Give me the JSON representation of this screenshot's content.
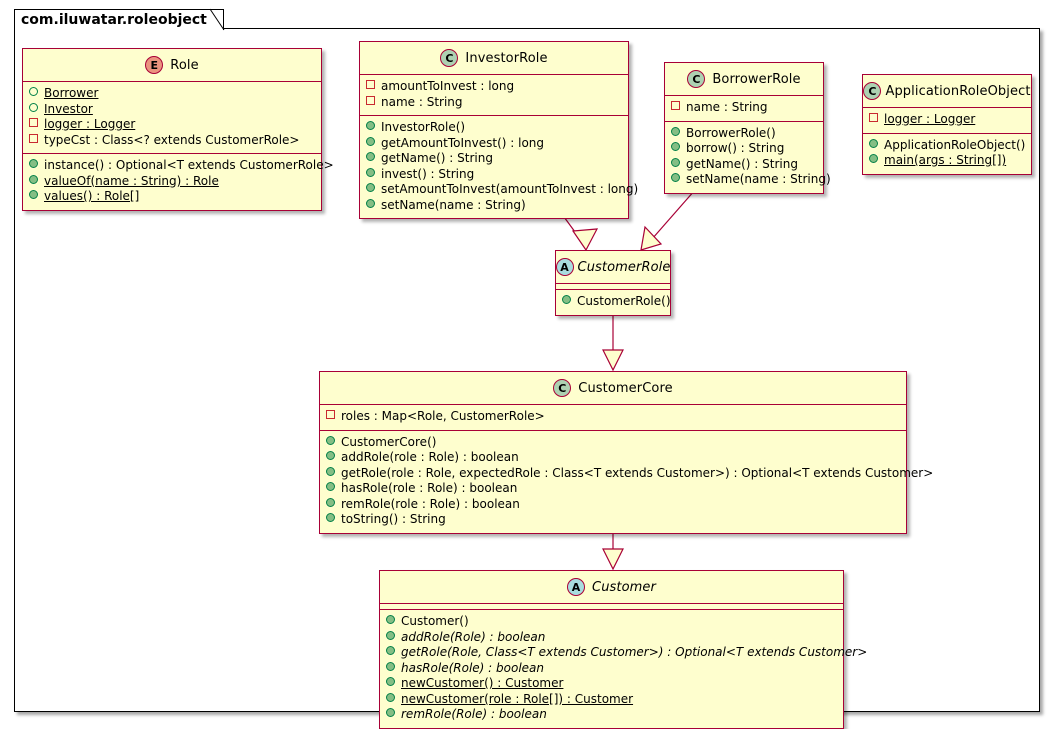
{
  "package": {
    "name": "com.iluwatar.roleobject"
  },
  "colors": {
    "box_fill": "#FEFECE",
    "box_border": "#A80036",
    "class_badge": "#ADD1B2",
    "abstract_badge": "#A9DCDF",
    "enum_badge": "#EB937F",
    "link": "#A80036",
    "public_member": "#84BE84",
    "private_member": "#C82930"
  },
  "classes": {
    "role": {
      "name": "Role",
      "stereotype": "E",
      "stereotype_name": "enum",
      "fields": [
        {
          "icon": "field-public",
          "text": "Borrower",
          "style": "underline"
        },
        {
          "icon": "field-public",
          "text": "Investor",
          "style": "underline"
        },
        {
          "icon": "field-private",
          "text": "logger : Logger",
          "style": "underline"
        },
        {
          "icon": "field-private",
          "text": "typeCst : Class<? extends CustomerRole>",
          "style": ""
        }
      ],
      "methods": [
        {
          "icon": "method-public",
          "text": "instance() : Optional<T extends CustomerRole>",
          "style": ""
        },
        {
          "icon": "method-public",
          "text": "valueOf(name : String) : Role",
          "style": "underline"
        },
        {
          "icon": "method-public",
          "text": "values() : Role[]",
          "style": "underline"
        }
      ]
    },
    "investor_role": {
      "name": "InvestorRole",
      "stereotype": "C",
      "stereotype_name": "class",
      "fields": [
        {
          "icon": "field-private",
          "text": "amountToInvest : long",
          "style": ""
        },
        {
          "icon": "field-private",
          "text": "name : String",
          "style": ""
        }
      ],
      "methods": [
        {
          "icon": "method-public",
          "text": "InvestorRole()",
          "style": ""
        },
        {
          "icon": "method-public",
          "text": "getAmountToInvest() : long",
          "style": ""
        },
        {
          "icon": "method-public",
          "text": "getName() : String",
          "style": ""
        },
        {
          "icon": "method-public",
          "text": "invest() : String",
          "style": ""
        },
        {
          "icon": "method-public",
          "text": "setAmountToInvest(amountToInvest : long)",
          "style": ""
        },
        {
          "icon": "method-public",
          "text": "setName(name : String)",
          "style": ""
        }
      ]
    },
    "borrower_role": {
      "name": "BorrowerRole",
      "stereotype": "C",
      "stereotype_name": "class",
      "fields": [
        {
          "icon": "field-private",
          "text": "name : String",
          "style": ""
        }
      ],
      "methods": [
        {
          "icon": "method-public",
          "text": "BorrowerRole()",
          "style": ""
        },
        {
          "icon": "method-public",
          "text": "borrow() : String",
          "style": ""
        },
        {
          "icon": "method-public",
          "text": "getName() : String",
          "style": ""
        },
        {
          "icon": "method-public",
          "text": "setName(name : String)",
          "style": ""
        }
      ]
    },
    "application_role_object": {
      "name": "ApplicationRoleObject",
      "stereotype": "C",
      "stereotype_name": "class",
      "fields": [
        {
          "icon": "field-private",
          "text": "logger : Logger",
          "style": "underline"
        }
      ],
      "methods": [
        {
          "icon": "method-public",
          "text": "ApplicationRoleObject()",
          "style": ""
        },
        {
          "icon": "method-public",
          "text": "main(args : String[])",
          "style": "underline"
        }
      ]
    },
    "customer_role": {
      "name": "CustomerRole",
      "stereotype": "A",
      "stereotype_name": "abstract",
      "fields": [],
      "methods": [
        {
          "icon": "method-public",
          "text": "CustomerRole()",
          "style": ""
        }
      ]
    },
    "customer_core": {
      "name": "CustomerCore",
      "stereotype": "C",
      "stereotype_name": "class",
      "fields": [
        {
          "icon": "field-private",
          "text": "roles : Map<Role, CustomerRole>",
          "style": ""
        }
      ],
      "methods": [
        {
          "icon": "method-public",
          "text": "CustomerCore()",
          "style": ""
        },
        {
          "icon": "method-public",
          "text": "addRole(role : Role) : boolean",
          "style": ""
        },
        {
          "icon": "method-public",
          "text": "getRole(role : Role, expectedRole : Class<T extends Customer>) : Optional<T extends Customer>",
          "style": ""
        },
        {
          "icon": "method-public",
          "text": "hasRole(role : Role) : boolean",
          "style": ""
        },
        {
          "icon": "method-public",
          "text": "remRole(role : Role) : boolean",
          "style": ""
        },
        {
          "icon": "method-public",
          "text": "toString() : String",
          "style": ""
        }
      ]
    },
    "customer": {
      "name": "Customer",
      "stereotype": "A",
      "stereotype_name": "abstract",
      "fields": [],
      "methods": [
        {
          "icon": "method-public",
          "text": "Customer()",
          "style": ""
        },
        {
          "icon": "method-public",
          "text": "addRole(Role) : boolean",
          "style": "italic"
        },
        {
          "icon": "method-public",
          "text": "getRole(Role, Class<T extends Customer>) : Optional<T extends Customer>",
          "style": "italic"
        },
        {
          "icon": "method-public",
          "text": "hasRole(Role) : boolean",
          "style": "italic"
        },
        {
          "icon": "method-public",
          "text": "newCustomer() : Customer",
          "style": "underline"
        },
        {
          "icon": "method-public",
          "text": "newCustomer(role : Role[]) : Customer",
          "style": "underline"
        },
        {
          "icon": "method-public",
          "text": "remRole(Role) : boolean",
          "style": "italic"
        }
      ]
    }
  },
  "relations": [
    {
      "from": "InvestorRole",
      "to": "CustomerRole",
      "type": "generalization"
    },
    {
      "from": "BorrowerRole",
      "to": "CustomerRole",
      "type": "generalization"
    },
    {
      "from": "CustomerRole",
      "to": "CustomerCore",
      "type": "generalization"
    },
    {
      "from": "CustomerCore",
      "to": "Customer",
      "type": "generalization"
    }
  ]
}
